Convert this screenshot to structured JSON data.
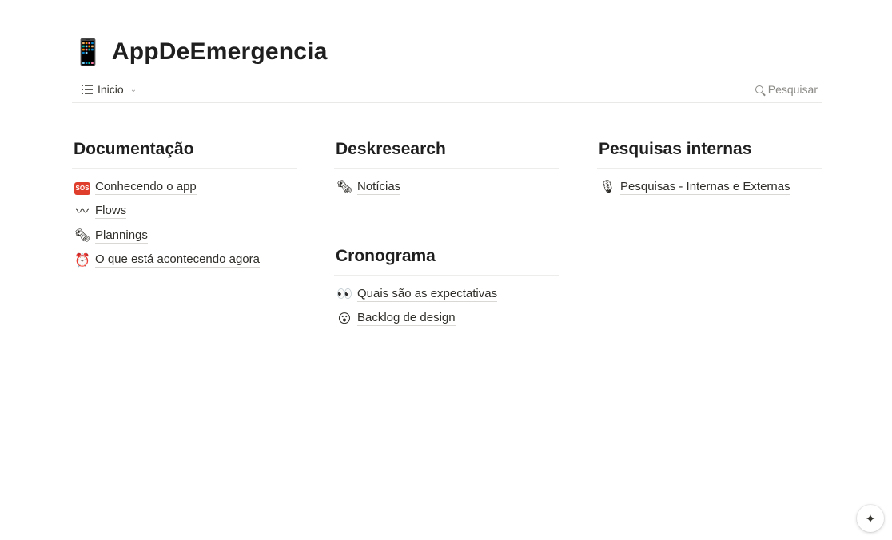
{
  "header": {
    "title": "AppDeEmergencia",
    "title_icon": "📱",
    "title_icon_name": "mobile-phone-icon"
  },
  "view_bar": {
    "tab_label": "Inicio",
    "tab_icon": "list-icon",
    "search_label": "Pesquisar"
  },
  "columns": {
    "documentacao": {
      "title": "Documentação",
      "items": [
        {
          "icon": "SOS",
          "icon_name": "sos-icon",
          "label": "Conhecendo o app"
        },
        {
          "icon": "〰",
          "icon_name": "wavy-line-icon",
          "label": "Flows"
        },
        {
          "icon": "🗞",
          "icon_name": "newspaper-icon",
          "label": "Plannings"
        },
        {
          "icon": "⏰",
          "icon_name": "alarm-clock-icon",
          "label": "O que está acontecendo agora"
        }
      ]
    },
    "deskresearch": {
      "title": "Deskresearch",
      "items": [
        {
          "icon": "🗞",
          "icon_name": "newspaper-icon",
          "label": "Notícias"
        }
      ]
    },
    "cronograma": {
      "title": "Cronograma",
      "items": [
        {
          "icon": "👀",
          "icon_name": "eyes-icon",
          "label": "Quais são as expectativas"
        },
        {
          "icon": "😮",
          "icon_name": "face-icon",
          "label": "Backlog de design"
        }
      ]
    },
    "pesquisas": {
      "title": "Pesquisas internas",
      "items": [
        {
          "icon": "🎙",
          "icon_name": "microphone-icon",
          "label": "Pesquisas - Internas e Externas"
        }
      ]
    }
  },
  "fab": {
    "icon": "✦",
    "icon_name": "sparkle-icon"
  },
  "colors": {
    "text": "#37352f",
    "divider": "#e9e9e7",
    "sos_badge": "#e03e2d"
  }
}
